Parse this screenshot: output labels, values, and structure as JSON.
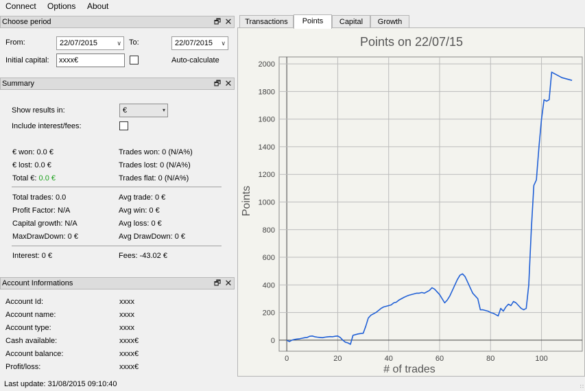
{
  "menu": {
    "connect": "Connect",
    "options": "Options",
    "about": "About"
  },
  "choose_period": {
    "title": "Choose period",
    "from_label": "From:",
    "from_value": "22/07/2015",
    "to_label": "To:",
    "to_value": "22/07/2015",
    "initial_capital_label": "Initial capital:",
    "initial_capital_value": "xxxx€",
    "auto_calculate_label": "Auto-calculate"
  },
  "summary": {
    "title": "Summary",
    "show_results_label": "Show results in:",
    "show_results_value": "€",
    "include_interest_label": "Include interest/fees:",
    "won": "€ won: 0.0 €",
    "lost": "€ lost: 0.0 €",
    "total_prefix": "Total €: ",
    "total_value": "0.0 €",
    "trades_won": "Trades won: 0 (N/A%)",
    "trades_lost": "Trades lost: 0 (N/A%)",
    "trades_flat": "Trades flat: 0 (N/A%)",
    "total_trades": "Total trades: 0.0",
    "profit_factor": "Profit Factor: N/A",
    "capital_growth": "Capital growth: N/A",
    "max_drawdown": "MaxDrawDown: 0 €",
    "avg_trade": "Avg trade: 0 €",
    "avg_win": "Avg win: 0 €",
    "avg_loss": "Avg loss: 0 €",
    "avg_drawdown": "Avg DrawDown: 0 €",
    "interest": "Interest: 0 €",
    "fees": "Fees: -43.02 €"
  },
  "account": {
    "title": "Account Informations",
    "rows": [
      {
        "label": "Account Id:",
        "value": "xxxx"
      },
      {
        "label": "Account name:",
        "value": "xxxx"
      },
      {
        "label": "Account type:",
        "value": "xxxx"
      },
      {
        "label": "Cash available:",
        "value": "xxxx€"
      },
      {
        "label": "Account balance:",
        "value": "xxxx€"
      },
      {
        "label": "Profit/loss:",
        "value": "xxxx€"
      }
    ]
  },
  "status": {
    "last_update": "Last update: 31/08/2015 09:10:40"
  },
  "tabs": [
    "Transactions",
    "Points",
    "Capital",
    "Growth"
  ],
  "icons": {
    "float": "float-icon",
    "close": "close-icon",
    "dropdown": "dropdown-arrow-icon"
  },
  "chart_data": {
    "type": "line",
    "title": "Points on 22/07/15",
    "xlabel": "# of trades",
    "ylabel": "Points",
    "xlim": [
      -3,
      116
    ],
    "ylim": [
      -80,
      2050
    ],
    "xticks": [
      0,
      20,
      40,
      60,
      80,
      100
    ],
    "yticks": [
      0,
      200,
      400,
      600,
      800,
      1000,
      1200,
      1400,
      1600,
      1800,
      2000
    ],
    "grid": true,
    "line_color": "#1f5fd6",
    "x": [
      0,
      1,
      2,
      3,
      4,
      5,
      6,
      7,
      8,
      9,
      10,
      11,
      12,
      13,
      14,
      15,
      16,
      17,
      18,
      19,
      20,
      21,
      22,
      23,
      24,
      25,
      26,
      27,
      28,
      29,
      30,
      31,
      32,
      33,
      34,
      35,
      36,
      37,
      38,
      39,
      40,
      41,
      42,
      43,
      44,
      45,
      46,
      47,
      48,
      49,
      50,
      51,
      52,
      53,
      54,
      55,
      56,
      57,
      58,
      59,
      60,
      61,
      62,
      63,
      64,
      65,
      66,
      67,
      68,
      69,
      70,
      71,
      72,
      73,
      74,
      75,
      76,
      77,
      78,
      79,
      80,
      81,
      82,
      83,
      84,
      85,
      86,
      87,
      88,
      89,
      90,
      91,
      92,
      93,
      94,
      95,
      96,
      97,
      98,
      99,
      100,
      101,
      102,
      103,
      104,
      105,
      106,
      107,
      108,
      109,
      110,
      111,
      112
    ],
    "y": [
      0,
      -10,
      0,
      5,
      8,
      10,
      14,
      18,
      20,
      28,
      30,
      25,
      22,
      20,
      18,
      22,
      24,
      26,
      25,
      28,
      30,
      20,
      0,
      -15,
      -20,
      -30,
      35,
      40,
      45,
      48,
      50,
      100,
      160,
      180,
      190,
      200,
      215,
      230,
      240,
      245,
      250,
      255,
      270,
      275,
      290,
      300,
      310,
      318,
      325,
      330,
      335,
      340,
      340,
      345,
      340,
      350,
      360,
      380,
      370,
      350,
      330,
      300,
      270,
      290,
      320,
      360,
      400,
      440,
      470,
      480,
      460,
      420,
      380,
      340,
      320,
      300,
      220,
      220,
      215,
      210,
      200,
      195,
      185,
      175,
      230,
      210,
      240,
      260,
      250,
      280,
      270,
      250,
      230,
      220,
      230,
      400,
      800,
      1120,
      1160,
      1400,
      1600,
      1740,
      1730,
      1740,
      1940,
      1930,
      1920,
      1910,
      1900,
      1895,
      1890,
      1885,
      1880
    ],
    "subset_note": ""
  }
}
